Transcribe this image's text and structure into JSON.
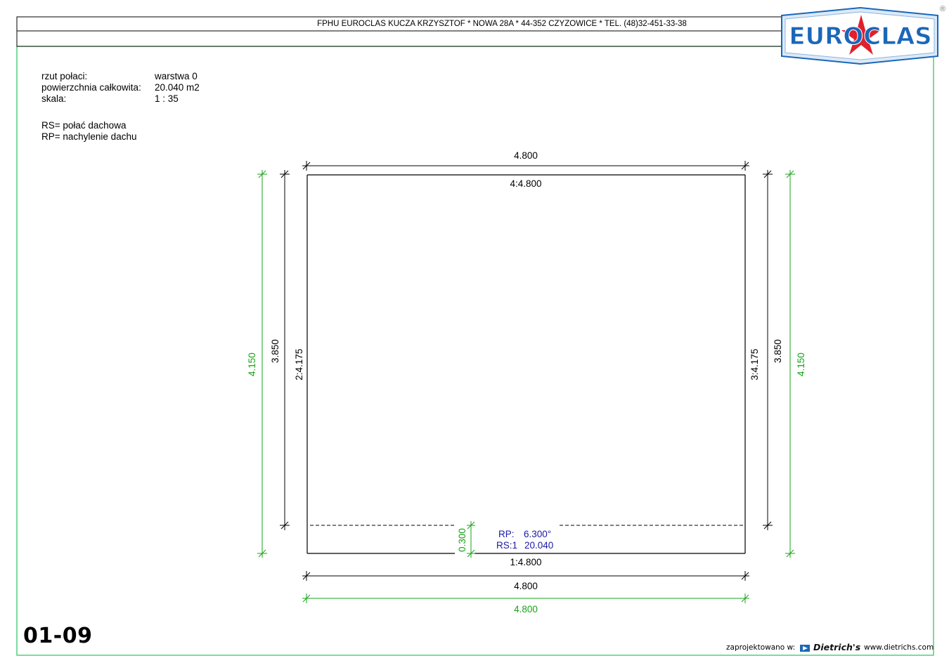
{
  "header": {
    "company_line": "FPHU EUROCLAS KUCZA KRZYSZTOF * NOWA 28A * 44-352 CZYZOWICE * TEL. (48)32-451-33-38",
    "logo_text": "EUROCLAS",
    "registered_mark": "®"
  },
  "info": {
    "labels": {
      "roof_plan": "rzut połaci:",
      "total_area": "powierzchnia całkowita:",
      "scale": "skala:"
    },
    "values": {
      "roof_plan": "warstwa 0",
      "total_area": "20.040 m2",
      "scale": "1 : 35"
    },
    "legend_rs": "RS= połać dachowa",
    "legend_rp": "RP= nachylenie dachu"
  },
  "drawing": {
    "dim_top": "4.800",
    "edge_top": "4:4.800",
    "edge_left": "2:4.175",
    "edge_right": "3:4.175",
    "edge_bottom": "1:4.800",
    "dim_left_inner": "3.850",
    "dim_right_inner": "3.850",
    "dim_left_outer": "4.150",
    "dim_right_outer": "4.150",
    "dim_bottom_black": "4.800",
    "dim_bottom_green": "4.800",
    "eave_overhang": "0.300",
    "rp_label": "RP:",
    "rp_value": "6.300°",
    "rs_label": "RS:1",
    "rs_value": "20.040"
  },
  "sheet_code": "01-09",
  "footer": {
    "designed_in": "zaprojektowano w:",
    "brand": "Dietrich's",
    "website": "www.dietrichs.com"
  },
  "colors": {
    "frame_green": "#22c55e",
    "dim_green": "#17a317",
    "roof_blue": "#1a1aa6",
    "logo_blue": "#1a67b8",
    "logo_red": "#e0202a"
  }
}
